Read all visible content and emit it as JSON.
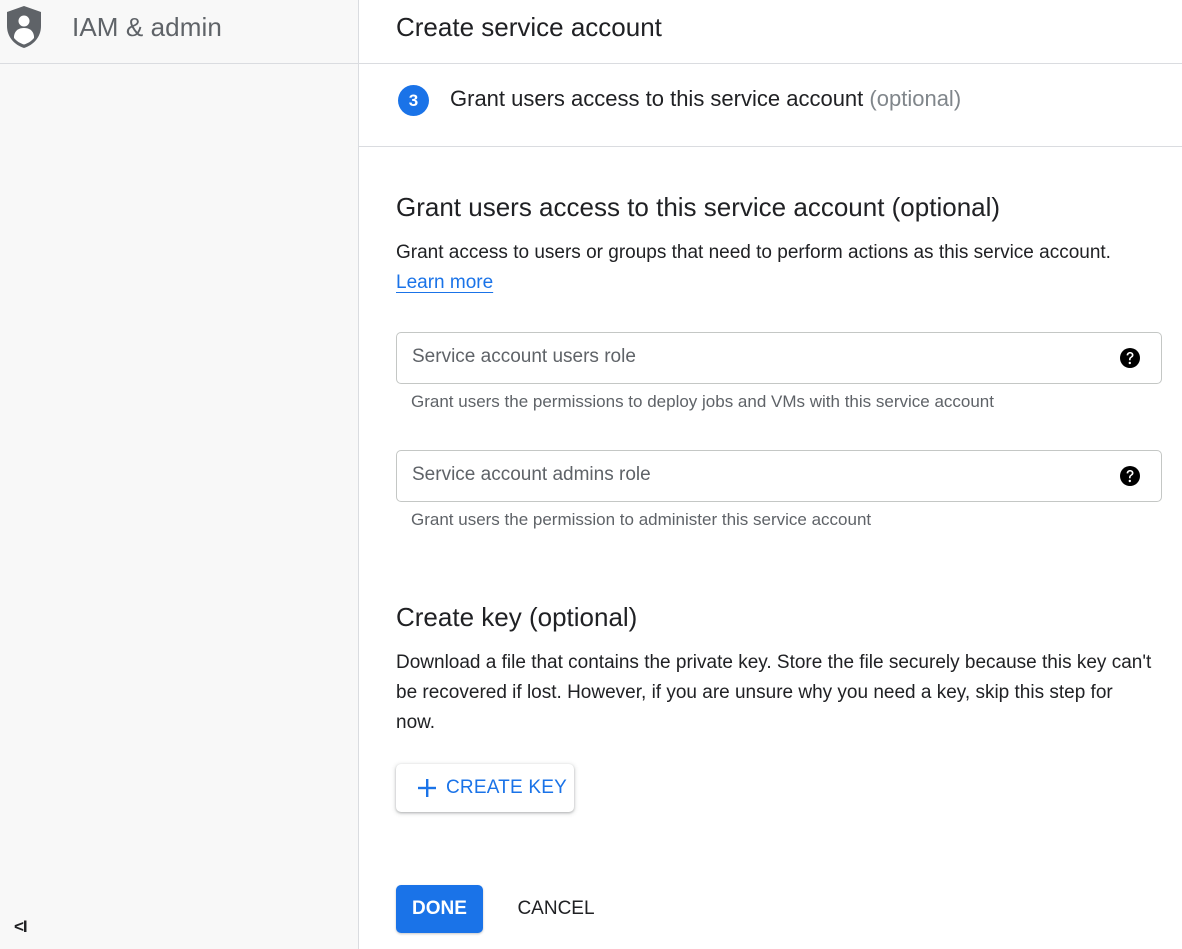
{
  "sidebar": {
    "product_icon": "shield-person-icon",
    "product_title": "IAM & admin",
    "collapse_label": "<I",
    "collapse_icon": "collapse-nav-icon"
  },
  "header": {
    "title": "Create service account"
  },
  "step": {
    "number": "3",
    "label": "Grant users access to this service account",
    "optional": "(optional)"
  },
  "grant_section": {
    "title": "Grant users access to this service account (optional)",
    "description": "Grant access to users or groups that need to perform actions as this service account.",
    "learn_more": "Learn more",
    "users_role": {
      "placeholder": "Service account users role",
      "value": "",
      "hint": "Grant users the permissions to deploy jobs and VMs with this service account",
      "help_icon": "help-circle-icon"
    },
    "admins_role": {
      "placeholder": "Service account admins role",
      "value": "",
      "hint": "Grant users the permission to administer this service account",
      "help_icon": "help-circle-icon"
    }
  },
  "key_section": {
    "title": "Create key (optional)",
    "description": "Download a file that contains the private key. Store the file securely because this key can't be recovered if lost. However, if you are unsure why you need a key, skip this step for now.",
    "create_key_label": "CREATE KEY",
    "create_key_icon": "plus-icon"
  },
  "actions": {
    "done_label": "DONE",
    "cancel_label": "CANCEL"
  },
  "colors": {
    "accent": "#1a73e8",
    "sidebar_bg": "#f8f8f8",
    "divider": "#dadce0",
    "secondary_text": "#5f6368"
  }
}
